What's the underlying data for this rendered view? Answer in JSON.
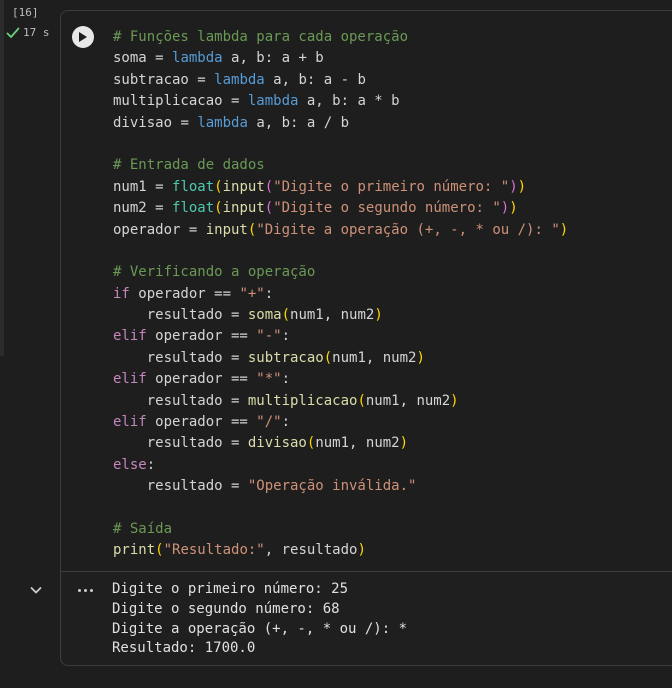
{
  "cell": {
    "execution_count": "[16]",
    "status_time": "17 s",
    "status": "success"
  },
  "code_lines": [
    [
      {
        "t": "# Funções lambda para cada operação",
        "c": "comment"
      }
    ],
    [
      {
        "t": "soma",
        "c": "var"
      },
      {
        "t": " = ",
        "c": "var"
      },
      {
        "t": "lambda",
        "c": "kw"
      },
      {
        "t": " a, b: a + b",
        "c": "var"
      }
    ],
    [
      {
        "t": "subtracao",
        "c": "var"
      },
      {
        "t": " = ",
        "c": "var"
      },
      {
        "t": "lambda",
        "c": "kw"
      },
      {
        "t": " a, b: a - b",
        "c": "var"
      }
    ],
    [
      {
        "t": "multiplicacao",
        "c": "var"
      },
      {
        "t": " = ",
        "c": "var"
      },
      {
        "t": "lambda",
        "c": "kw"
      },
      {
        "t": " a, b: a * b",
        "c": "var"
      }
    ],
    [
      {
        "t": "divisao",
        "c": "var"
      },
      {
        "t": " = ",
        "c": "var"
      },
      {
        "t": "lambda",
        "c": "kw"
      },
      {
        "t": " a, b: a / b",
        "c": "var"
      }
    ],
    [],
    [
      {
        "t": "# Entrada de dados",
        "c": "comment"
      }
    ],
    [
      {
        "t": "num1 = ",
        "c": "var"
      },
      {
        "t": "float",
        "c": "fn"
      },
      {
        "t": "(",
        "c": "p1"
      },
      {
        "t": "input",
        "c": "call"
      },
      {
        "t": "(",
        "c": "p2"
      },
      {
        "t": "\"Digite o primeiro número: \"",
        "c": "str"
      },
      {
        "t": ")",
        "c": "p2"
      },
      {
        "t": ")",
        "c": "p1"
      }
    ],
    [
      {
        "t": "num2 = ",
        "c": "var"
      },
      {
        "t": "float",
        "c": "fn"
      },
      {
        "t": "(",
        "c": "p1"
      },
      {
        "t": "input",
        "c": "call"
      },
      {
        "t": "(",
        "c": "p2"
      },
      {
        "t": "\"Digite o segundo número: \"",
        "c": "str"
      },
      {
        "t": ")",
        "c": "p2"
      },
      {
        "t": ")",
        "c": "p1"
      }
    ],
    [
      {
        "t": "operador = ",
        "c": "var"
      },
      {
        "t": "input",
        "c": "call"
      },
      {
        "t": "(",
        "c": "p1"
      },
      {
        "t": "\"Digite a operação (+, -, * ou /): \"",
        "c": "str"
      },
      {
        "t": ")",
        "c": "p1"
      }
    ],
    [],
    [
      {
        "t": "# Verificando a operação",
        "c": "comment"
      }
    ],
    [
      {
        "t": "if",
        "c": "ctrl"
      },
      {
        "t": " operador == ",
        "c": "var"
      },
      {
        "t": "\"+\"",
        "c": "str"
      },
      {
        "t": ":",
        "c": "var"
      }
    ],
    [
      {
        "t": "    resultado = ",
        "c": "var"
      },
      {
        "t": "soma",
        "c": "call"
      },
      {
        "t": "(",
        "c": "p1"
      },
      {
        "t": "num1, num2",
        "c": "var"
      },
      {
        "t": ")",
        "c": "p1"
      }
    ],
    [
      {
        "t": "elif",
        "c": "ctrl"
      },
      {
        "t": " operador == ",
        "c": "var"
      },
      {
        "t": "\"-\"",
        "c": "str"
      },
      {
        "t": ":",
        "c": "var"
      }
    ],
    [
      {
        "t": "    resultado = ",
        "c": "var"
      },
      {
        "t": "subtracao",
        "c": "call"
      },
      {
        "t": "(",
        "c": "p1"
      },
      {
        "t": "num1, num2",
        "c": "var"
      },
      {
        "t": ")",
        "c": "p1"
      }
    ],
    [
      {
        "t": "elif",
        "c": "ctrl"
      },
      {
        "t": " operador == ",
        "c": "var"
      },
      {
        "t": "\"*\"",
        "c": "str"
      },
      {
        "t": ":",
        "c": "var"
      }
    ],
    [
      {
        "t": "    resultado = ",
        "c": "var"
      },
      {
        "t": "multiplicacao",
        "c": "call"
      },
      {
        "t": "(",
        "c": "p1"
      },
      {
        "t": "num1, num2",
        "c": "var"
      },
      {
        "t": ")",
        "c": "p1"
      }
    ],
    [
      {
        "t": "elif",
        "c": "ctrl"
      },
      {
        "t": " operador == ",
        "c": "var"
      },
      {
        "t": "\"/\"",
        "c": "str"
      },
      {
        "t": ":",
        "c": "var"
      }
    ],
    [
      {
        "t": "    resultado = ",
        "c": "var"
      },
      {
        "t": "divisao",
        "c": "call"
      },
      {
        "t": "(",
        "c": "p1"
      },
      {
        "t": "num1, num2",
        "c": "var"
      },
      {
        "t": ")",
        "c": "p1"
      }
    ],
    [
      {
        "t": "else",
        "c": "ctrl"
      },
      {
        "t": ":",
        "c": "var"
      }
    ],
    [
      {
        "t": "    resultado = ",
        "c": "var"
      },
      {
        "t": "\"Operação inválida.\"",
        "c": "str"
      }
    ],
    [],
    [
      {
        "t": "# Saída",
        "c": "comment"
      }
    ],
    [
      {
        "t": "print",
        "c": "call"
      },
      {
        "t": "(",
        "c": "p1"
      },
      {
        "t": "\"Resultado:\"",
        "c": "str"
      },
      {
        "t": ", resultado",
        "c": "var"
      },
      {
        "t": ")",
        "c": "p1"
      }
    ]
  ],
  "output_lines": [
    "Digite o primeiro número: 25",
    "Digite o segundo número: 68",
    "Digite a operação (+, -, * ou /): *",
    "Resultado: 1700.0"
  ],
  "icons": {
    "run": "play-icon",
    "status": "check-icon",
    "collapse": "chevron-down-icon",
    "more": "more-horizontal-icon"
  },
  "colors": {
    "background": "#1e1e1e",
    "check": "#6ccf7c",
    "comment": "#6a9955",
    "keyword": "#569cd6",
    "control": "#c586c0",
    "string": "#ce9178"
  }
}
